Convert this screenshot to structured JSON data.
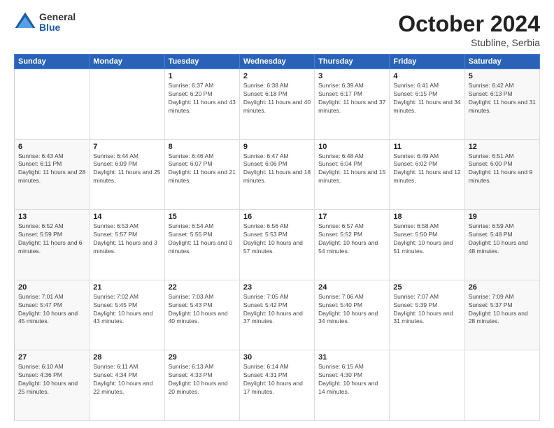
{
  "header": {
    "logo_general": "General",
    "logo_blue": "Blue",
    "month_title": "October 2024",
    "location": "Stubline, Serbia"
  },
  "days_of_week": [
    "Sunday",
    "Monday",
    "Tuesday",
    "Wednesday",
    "Thursday",
    "Friday",
    "Saturday"
  ],
  "weeks": [
    [
      {
        "day": "",
        "info": ""
      },
      {
        "day": "",
        "info": ""
      },
      {
        "day": "1",
        "info": "Sunrise: 6:37 AM\nSunset: 6:20 PM\nDaylight: 11 hours and 43 minutes."
      },
      {
        "day": "2",
        "info": "Sunrise: 6:38 AM\nSunset: 6:18 PM\nDaylight: 11 hours and 40 minutes."
      },
      {
        "day": "3",
        "info": "Sunrise: 6:39 AM\nSunset: 6:17 PM\nDaylight: 11 hours and 37 minutes."
      },
      {
        "day": "4",
        "info": "Sunrise: 6:41 AM\nSunset: 6:15 PM\nDaylight: 11 hours and 34 minutes."
      },
      {
        "day": "5",
        "info": "Sunrise: 6:42 AM\nSunset: 6:13 PM\nDaylight: 11 hours and 31 minutes."
      }
    ],
    [
      {
        "day": "6",
        "info": "Sunrise: 6:43 AM\nSunset: 6:11 PM\nDaylight: 11 hours and 28 minutes."
      },
      {
        "day": "7",
        "info": "Sunrise: 6:44 AM\nSunset: 6:09 PM\nDaylight: 11 hours and 25 minutes."
      },
      {
        "day": "8",
        "info": "Sunrise: 6:46 AM\nSunset: 6:07 PM\nDaylight: 11 hours and 21 minutes."
      },
      {
        "day": "9",
        "info": "Sunrise: 6:47 AM\nSunset: 6:06 PM\nDaylight: 11 hours and 18 minutes."
      },
      {
        "day": "10",
        "info": "Sunrise: 6:48 AM\nSunset: 6:04 PM\nDaylight: 11 hours and 15 minutes."
      },
      {
        "day": "11",
        "info": "Sunrise: 6:49 AM\nSunset: 6:02 PM\nDaylight: 11 hours and 12 minutes."
      },
      {
        "day": "12",
        "info": "Sunrise: 6:51 AM\nSunset: 6:00 PM\nDaylight: 11 hours and 9 minutes."
      }
    ],
    [
      {
        "day": "13",
        "info": "Sunrise: 6:52 AM\nSunset: 5:59 PM\nDaylight: 11 hours and 6 minutes."
      },
      {
        "day": "14",
        "info": "Sunrise: 6:53 AM\nSunset: 5:57 PM\nDaylight: 11 hours and 3 minutes."
      },
      {
        "day": "15",
        "info": "Sunrise: 6:54 AM\nSunset: 5:55 PM\nDaylight: 11 hours and 0 minutes."
      },
      {
        "day": "16",
        "info": "Sunrise: 6:56 AM\nSunset: 5:53 PM\nDaylight: 10 hours and 57 minutes."
      },
      {
        "day": "17",
        "info": "Sunrise: 6:57 AM\nSunset: 5:52 PM\nDaylight: 10 hours and 54 minutes."
      },
      {
        "day": "18",
        "info": "Sunrise: 6:58 AM\nSunset: 5:50 PM\nDaylight: 10 hours and 51 minutes."
      },
      {
        "day": "19",
        "info": "Sunrise: 6:59 AM\nSunset: 5:48 PM\nDaylight: 10 hours and 48 minutes."
      }
    ],
    [
      {
        "day": "20",
        "info": "Sunrise: 7:01 AM\nSunset: 5:47 PM\nDaylight: 10 hours and 45 minutes."
      },
      {
        "day": "21",
        "info": "Sunrise: 7:02 AM\nSunset: 5:45 PM\nDaylight: 10 hours and 43 minutes."
      },
      {
        "day": "22",
        "info": "Sunrise: 7:03 AM\nSunset: 5:43 PM\nDaylight: 10 hours and 40 minutes."
      },
      {
        "day": "23",
        "info": "Sunrise: 7:05 AM\nSunset: 5:42 PM\nDaylight: 10 hours and 37 minutes."
      },
      {
        "day": "24",
        "info": "Sunrise: 7:06 AM\nSunset: 5:40 PM\nDaylight: 10 hours and 34 minutes."
      },
      {
        "day": "25",
        "info": "Sunrise: 7:07 AM\nSunset: 5:39 PM\nDaylight: 10 hours and 31 minutes."
      },
      {
        "day": "26",
        "info": "Sunrise: 7:09 AM\nSunset: 5:37 PM\nDaylight: 10 hours and 28 minutes."
      }
    ],
    [
      {
        "day": "27",
        "info": "Sunrise: 6:10 AM\nSunset: 4:36 PM\nDaylight: 10 hours and 25 minutes."
      },
      {
        "day": "28",
        "info": "Sunrise: 6:11 AM\nSunset: 4:34 PM\nDaylight: 10 hours and 22 minutes."
      },
      {
        "day": "29",
        "info": "Sunrise: 6:13 AM\nSunset: 4:33 PM\nDaylight: 10 hours and 20 minutes."
      },
      {
        "day": "30",
        "info": "Sunrise: 6:14 AM\nSunset: 4:31 PM\nDaylight: 10 hours and 17 minutes."
      },
      {
        "day": "31",
        "info": "Sunrise: 6:15 AM\nSunset: 4:30 PM\nDaylight: 10 hours and 14 minutes."
      },
      {
        "day": "",
        "info": ""
      },
      {
        "day": "",
        "info": ""
      }
    ]
  ]
}
